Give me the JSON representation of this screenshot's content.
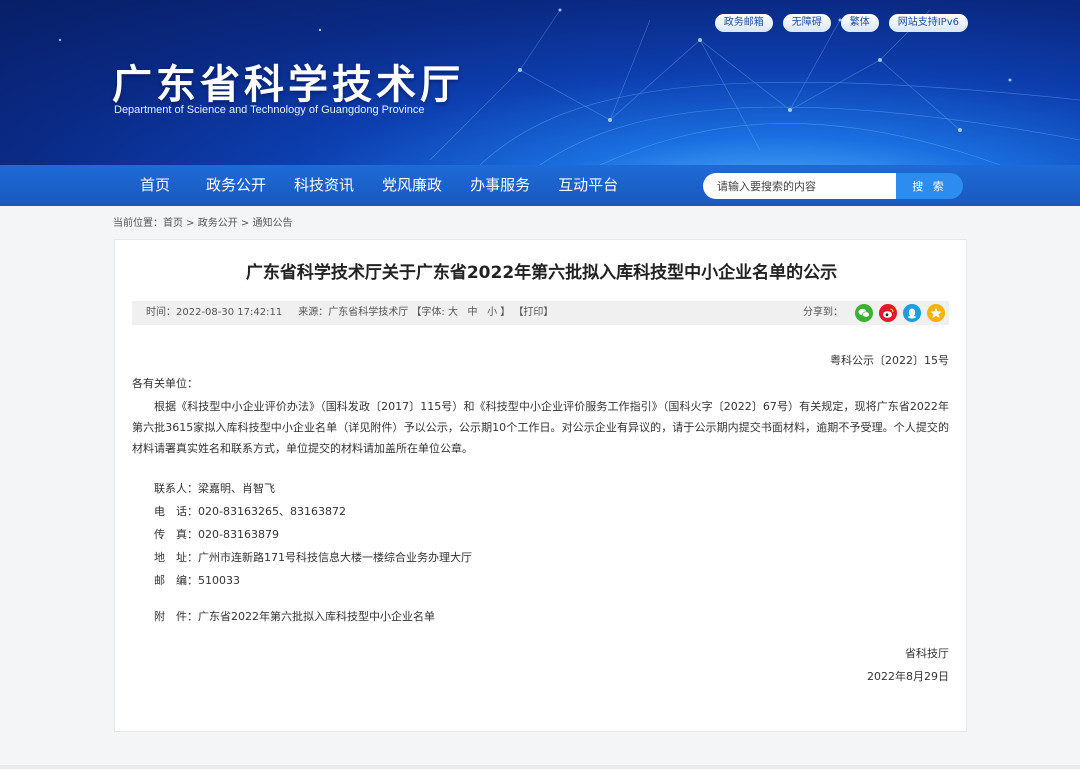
{
  "header": {
    "top_links": [
      "政务邮箱",
      "无障碍",
      "繁体",
      "网站支持IPv6"
    ],
    "title": "广东省科学技术厅",
    "subtitle": "Department of Science and Technology of Guangdong Province"
  },
  "nav": {
    "items": [
      "首页",
      "政务公开",
      "科技资讯",
      "党风廉政",
      "办事服务",
      "互动平台"
    ],
    "search_placeholder": "请输入要搜索的内容",
    "search_button": "搜 索"
  },
  "breadcrumb": {
    "prefix": "当前位置：",
    "items": [
      "首页",
      "政务公开",
      "通知公告"
    ],
    "separator": " > "
  },
  "article": {
    "title": "广东省科学技术厅关于广东省2022年第六批拟入库科技型中小企业名单的公示",
    "meta": {
      "time": "时间：2022-08-30 17:42:11",
      "source": "来源：广东省科学技术厅",
      "font_label": "【字体:",
      "font_sizes": [
        "大",
        "中",
        "小"
      ],
      "font_close": "】",
      "print": "【打印】",
      "share_label": "分享到："
    },
    "doc_number": "粤科公示〔2022〕15号",
    "greeting": "各有关单位：",
    "body": "根据《科技型中小企业评价办法》（国科发政〔2017〕115号）和《科技型中小企业评价服务工作指引》（国科火字〔2022〕67号）有关规定，现将广东省2022年第六批3615家拟入库科技型中小企业名单（详见附件）予以公示，公示期10个工作日。对公示企业有异议的，请于公示期内提交书面材料，逾期不予受理。个人提交的材料请署真实姓名和联系方式，单位提交的材料请加盖所在单位公章。",
    "contacts": [
      "联系人：梁嘉明、肖智飞",
      "电　话：020-83163265、83163872",
      "传　真：020-83163879",
      "地　址：广州市连新路171号科技信息大楼一楼综合业务办理大厅",
      "邮　编：510033"
    ],
    "attachment": "附　件：广东省2022年第六批拟入库科技型中小企业名单",
    "signature": "省科技厅",
    "date": "2022年8月29日"
  },
  "share_icons": [
    {
      "name": "wechat-icon",
      "color": "#3cb034"
    },
    {
      "name": "weibo-icon",
      "color": "#e6162d"
    },
    {
      "name": "qq-icon",
      "color": "#1a9ee0"
    },
    {
      "name": "qzone-icon",
      "color": "#f5b400"
    }
  ]
}
